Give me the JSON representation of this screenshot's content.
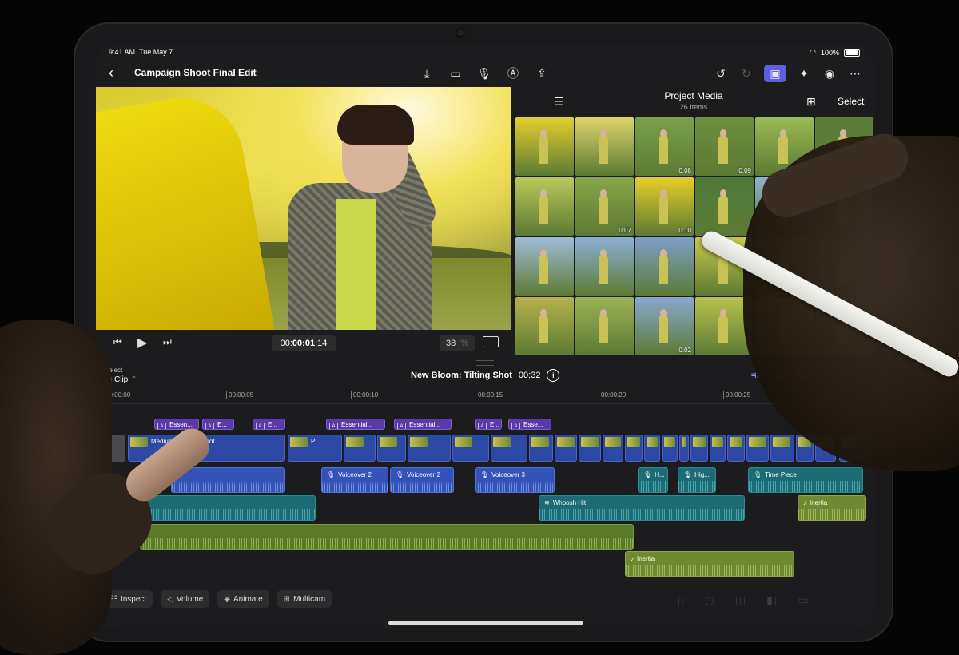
{
  "status": {
    "time": "9:41 AM",
    "date": "Tue May 7",
    "battery": "100%"
  },
  "nav": {
    "title": "Campaign Shoot Final Edit",
    "toolbar_icons": [
      "import-icon",
      "camera-icon",
      "microphone-icon",
      "voiceover-a-icon",
      "share-icon"
    ],
    "right_icons": [
      "undo-icon",
      "redo-icon",
      "photos-icon",
      "effects-icon",
      "inspector-icon",
      "more-icon"
    ]
  },
  "viewer": {
    "timecode_prefix": "00:",
    "timecode_main": "00:01",
    "timecode_frames": ":14",
    "zoom_value": "38",
    "zoom_unit": "%"
  },
  "browser": {
    "title": "Project Media",
    "count": "26 Items",
    "select_label": "Select",
    "thumbs": [
      {
        "dur": "",
        "bg": "#e4cf2e"
      },
      {
        "dur": "",
        "bg": "#dcd46a"
      },
      {
        "dur": "0:08",
        "bg": "#7aa24a"
      },
      {
        "dur": "0:09",
        "bg": "#6e8f3e"
      },
      {
        "dur": "",
        "bg": "#9abb55"
      },
      {
        "dur": "",
        "bg": "#5c7e3a"
      },
      {
        "dur": "",
        "bg": "#b9c85a"
      },
      {
        "dur": "0:07",
        "bg": "#86a648"
      },
      {
        "dur": "0:10",
        "bg": "#e7cf28"
      },
      {
        "dur": "",
        "bg": "#4f7a3a"
      },
      {
        "dur": "",
        "bg": "#8fb2cc"
      },
      {
        "dur": "",
        "bg": "#6a8b40"
      },
      {
        "dur": "",
        "bg": "#9fbcd8"
      },
      {
        "dur": "",
        "bg": "#8cb0d6"
      },
      {
        "dur": "",
        "bg": "#7d9fc8"
      },
      {
        "dur": "",
        "bg": "#c9c84a"
      },
      {
        "dur": "",
        "bg": "#a7b24c"
      },
      {
        "dur": "",
        "bg": "#7e9a44"
      },
      {
        "dur": "",
        "bg": "#b5b24a"
      },
      {
        "dur": "",
        "bg": "#9bb256"
      },
      {
        "dur": "0:02",
        "bg": "#8aa7cf"
      },
      {
        "dur": "",
        "bg": "#b8c24c"
      },
      {
        "dur": "",
        "bg": "#d8c03a"
      },
      {
        "dur": "",
        "bg": "#8a9e44"
      }
    ]
  },
  "timeline": {
    "select_label": "Select",
    "clip_label": "Clip",
    "project_name": "New Bloom: Tilting Shot",
    "duration": "00:32",
    "ruler": [
      {
        "label": "00:00:00"
      },
      {
        "label": "00:00:05"
      },
      {
        "label": "00:00:10"
      },
      {
        "label": "00:00:15"
      },
      {
        "label": "00:00:20"
      },
      {
        "label": "00:00:25"
      }
    ],
    "titles": [
      {
        "label": "Essen..."
      },
      {
        "label": "E..."
      },
      {
        "label": "E..."
      },
      {
        "label": "Essential..."
      },
      {
        "label": "Essential..."
      },
      {
        "label": "E..."
      },
      {
        "label": "Esse..."
      }
    ],
    "primary_first_label": "Medium Close up shot",
    "primary_second_label": "P...",
    "voiceovers": [
      {
        "label": "Voiceover 2"
      },
      {
        "label": "Voiceover 2"
      },
      {
        "label": "Voiceover 3"
      },
      {
        "label": "H..."
      },
      {
        "label": "Hig..."
      },
      {
        "label": "Time Piece"
      }
    ],
    "whoosh": "Whoosh Hit",
    "inertia1": "Inertia",
    "inertia2": "Inertia"
  },
  "bottom_toolbar": [
    {
      "label": "Inspect",
      "icon": "sliders-icon"
    },
    {
      "label": "Volume",
      "icon": "speaker-icon"
    },
    {
      "label": "Animate",
      "icon": "keyframe-icon"
    },
    {
      "label": "Multicam",
      "icon": "grid-icon"
    }
  ]
}
